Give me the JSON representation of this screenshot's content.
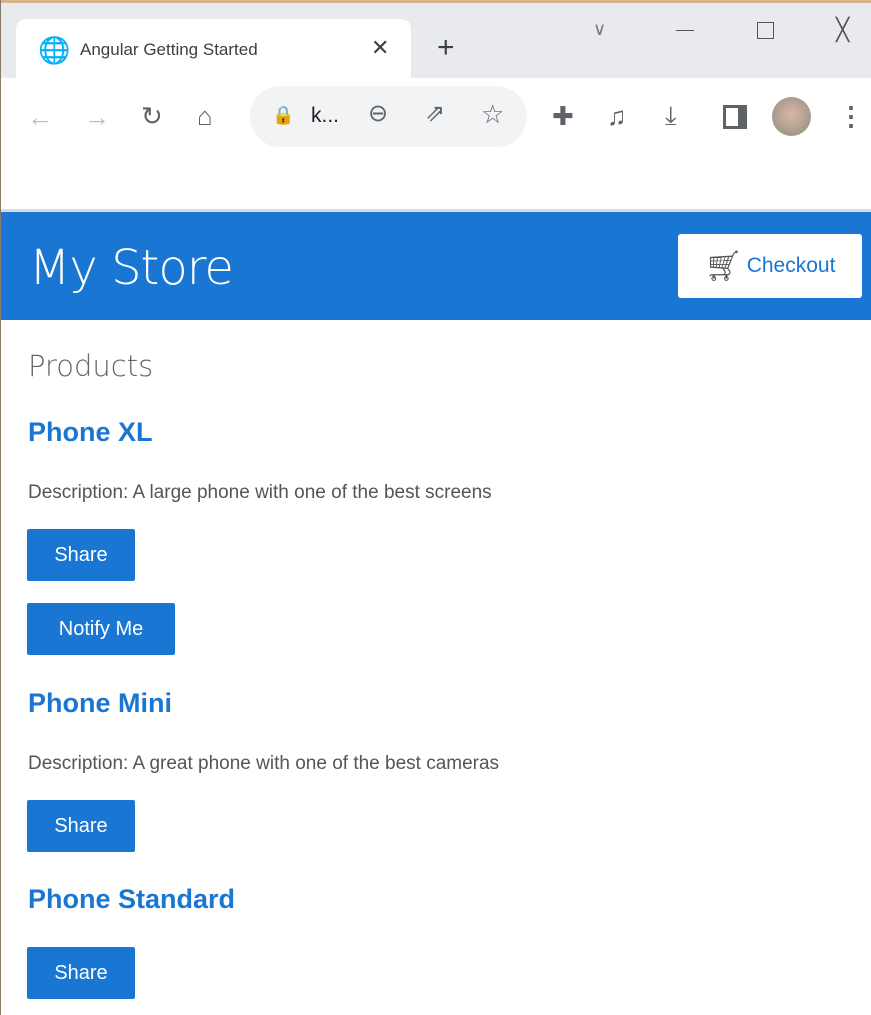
{
  "browser": {
    "tab_title": "Angular Getting Started",
    "address": "k...",
    "icons": [
      "globe-icon",
      "close-icon",
      "new-tab-icon",
      "back-icon",
      "forward-icon",
      "reload-icon",
      "home-icon",
      "lock-icon",
      "zoom-out-icon",
      "share-icon",
      "star-icon",
      "extensions-icon",
      "media-icon",
      "download-icon",
      "side-panel-icon",
      "avatar",
      "menu-icon"
    ]
  },
  "header": {
    "title": "My Store",
    "checkout_label": "Checkout",
    "accent": "#1976d2"
  },
  "main": {
    "section_title": "Products",
    "products": [
      {
        "name": "Phone XL",
        "description": "Description: A large phone with one of the best screens",
        "share": "Share",
        "notify": "Notify Me"
      },
      {
        "name": "Phone Mini",
        "description": "Description: A great phone with one of the best cameras",
        "share": "Share"
      },
      {
        "name": "Phone Standard",
        "share": "Share"
      }
    ]
  }
}
